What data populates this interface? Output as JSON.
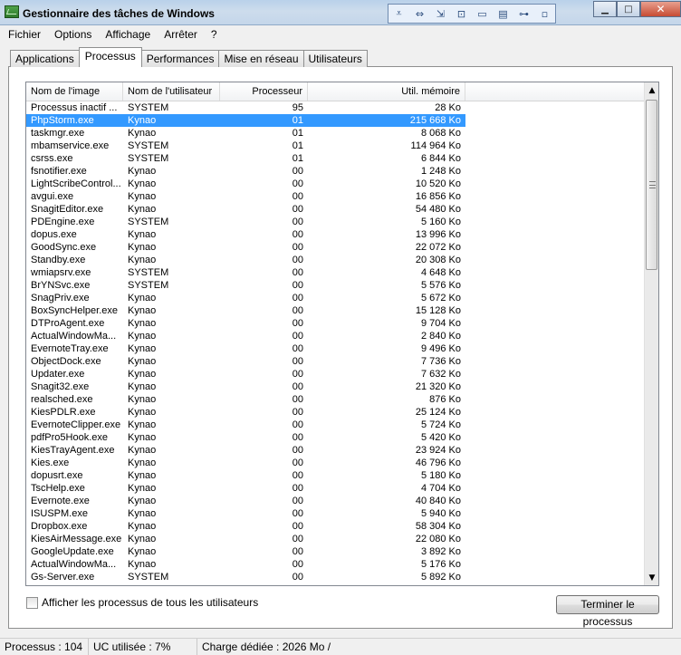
{
  "window": {
    "title": "Gestionnaire des tâches de Windows"
  },
  "quick_toolbar": [
    {
      "icon": "collapse-down-icon",
      "glyph": "⩡"
    },
    {
      "icon": "arrows-icon",
      "glyph": "⇔"
    },
    {
      "icon": "import-icon",
      "glyph": "⇲"
    },
    {
      "icon": "box-icon",
      "glyph": "⊡"
    },
    {
      "icon": "window-icon",
      "glyph": "▭"
    },
    {
      "icon": "monitor-icon",
      "glyph": "▤"
    },
    {
      "icon": "key-icon",
      "glyph": "⊶"
    },
    {
      "icon": "small-square-icon",
      "glyph": "▫"
    }
  ],
  "window_buttons": {
    "minimize": "▁",
    "maximize": "□",
    "close": "✕"
  },
  "menu": [
    "Fichier",
    "Options",
    "Affichage",
    "Arrêter",
    "?"
  ],
  "tabs": [
    "Applications",
    "Processus",
    "Performances",
    "Mise en réseau",
    "Utilisateurs"
  ],
  "active_tab": "Processus",
  "columns": [
    "Nom de l'image",
    "Nom de l'utilisateur",
    "Processeur",
    "Util. mémoire"
  ],
  "processes": [
    [
      "Processus inactif ...",
      "SYSTEM",
      "95",
      "28 Ko"
    ],
    [
      "PhpStorm.exe",
      "Kynao",
      "01",
      "215 668 Ko"
    ],
    [
      "taskmgr.exe",
      "Kynao",
      "01",
      "8 068 Ko"
    ],
    [
      "mbamservice.exe",
      "SYSTEM",
      "01",
      "114 964 Ko"
    ],
    [
      "csrss.exe",
      "SYSTEM",
      "01",
      "6 844 Ko"
    ],
    [
      "fsnotifier.exe",
      "Kynao",
      "00",
      "1 248 Ko"
    ],
    [
      "LightScribeControl...",
      "Kynao",
      "00",
      "10 520 Ko"
    ],
    [
      "avgui.exe",
      "Kynao",
      "00",
      "16 856 Ko"
    ],
    [
      "SnagitEditor.exe",
      "Kynao",
      "00",
      "54 480 Ko"
    ],
    [
      "PDEngine.exe",
      "SYSTEM",
      "00",
      "5 160 Ko"
    ],
    [
      "dopus.exe",
      "Kynao",
      "00",
      "13 996 Ko"
    ],
    [
      "GoodSync.exe",
      "Kynao",
      "00",
      "22 072 Ko"
    ],
    [
      "Standby.exe",
      "Kynao",
      "00",
      "20 308 Ko"
    ],
    [
      "wmiapsrv.exe",
      "SYSTEM",
      "00",
      "4 648 Ko"
    ],
    [
      "BrYNSvc.exe",
      "SYSTEM",
      "00",
      "5 576 Ko"
    ],
    [
      "SnagPriv.exe",
      "Kynao",
      "00",
      "5 672 Ko"
    ],
    [
      "BoxSyncHelper.exe",
      "Kynao",
      "00",
      "15 128 Ko"
    ],
    [
      "DTProAgent.exe",
      "Kynao",
      "00",
      "9 704 Ko"
    ],
    [
      "ActualWindowMa...",
      "Kynao",
      "00",
      "2 840 Ko"
    ],
    [
      "EvernoteTray.exe",
      "Kynao",
      "00",
      "9 496 Ko"
    ],
    [
      "ObjectDock.exe",
      "Kynao",
      "00",
      "7 736 Ko"
    ],
    [
      "Updater.exe",
      "Kynao",
      "00",
      "7 632 Ko"
    ],
    [
      "Snagit32.exe",
      "Kynao",
      "00",
      "21 320 Ko"
    ],
    [
      "realsched.exe",
      "Kynao",
      "00",
      "876 Ko"
    ],
    [
      "KiesPDLR.exe",
      "Kynao",
      "00",
      "25 124 Ko"
    ],
    [
      "EvernoteClipper.exe",
      "Kynao",
      "00",
      "5 724 Ko"
    ],
    [
      "pdfPro5Hook.exe",
      "Kynao",
      "00",
      "5 420 Ko"
    ],
    [
      "KiesTrayAgent.exe",
      "Kynao",
      "00",
      "23 924 Ko"
    ],
    [
      "Kies.exe",
      "Kynao",
      "00",
      "46 796 Ko"
    ],
    [
      "dopusrt.exe",
      "Kynao",
      "00",
      "5 180 Ko"
    ],
    [
      "TscHelp.exe",
      "Kynao",
      "00",
      "4 704 Ko"
    ],
    [
      "Evernote.exe",
      "Kynao",
      "00",
      "40 840 Ko"
    ],
    [
      "ISUSPM.exe",
      "Kynao",
      "00",
      "5 940 Ko"
    ],
    [
      "Dropbox.exe",
      "Kynao",
      "00",
      "58 304 Ko"
    ],
    [
      "KiesAirMessage.exe",
      "Kynao",
      "00",
      "22 080 Ko"
    ],
    [
      "GoogleUpdate.exe",
      "Kynao",
      "00",
      "3 892 Ko"
    ],
    [
      "ActualWindowMa...",
      "Kynao",
      "00",
      "5 176 Ko"
    ],
    [
      "Gs-Server.exe",
      "SYSTEM",
      "00",
      "5 892 Ko"
    ]
  ],
  "selected_index": 1,
  "scrollbar": {
    "up": "▲",
    "down": "▼"
  },
  "show_all_users_label": "Afficher les processus de tous les utilisateurs",
  "end_process_label": "Terminer le processus",
  "status": {
    "processes": "Processus : 104",
    "cpu": "UC utilisée : 7%",
    "commit": "Charge dédiée : 2026 Mo /"
  }
}
